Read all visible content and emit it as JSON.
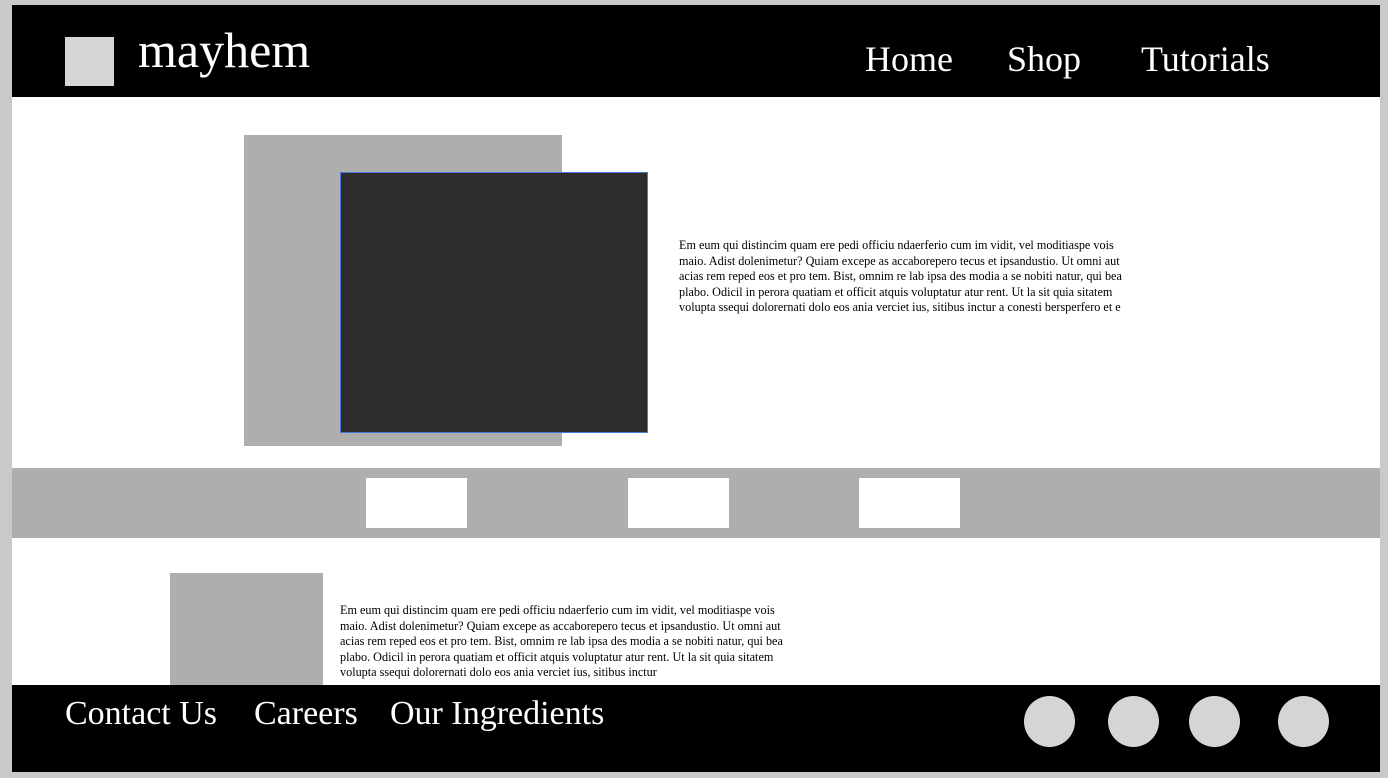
{
  "header": {
    "brand": "mayhem",
    "logo_icon": "logo-placeholder-icon",
    "nav": {
      "home": "Home",
      "shop": "Shop",
      "tutorials": "Tutorials"
    }
  },
  "hero": {
    "text": "Em eum qui distincim quam ere pedi officiu ndaerferio cum im vidit, vel moditiaspe vois maio. Adist dolenimetur? Quiam excepe as accaborepero tecus et ipsandustio. Ut omni aut acias rem reped eos et pro tem. Bist, omnim re lab ipsa des modia a se nobiti natur, qui bea plabo. Odicil in perora quatiam et officit atquis voluptatur atur rent. Ut la sit quia sitatem volupta ssequi dolorernati dolo eos ania verciet ius, sitibus inctur a conesti bersperfero et e"
  },
  "feature": {
    "text": "Em eum qui distincim quam ere pedi officiu ndaerferio cum im vidit, vel moditiaspe vois maio. Adist dolenimetur? Quiam excepe as accaborepero tecus et ipsandustio. Ut omni aut acias rem reped eos et pro tem. Bist, omnim re lab ipsa des modia a se nobiti natur, qui bea plabo. Odicil in perora quatiam et officit atquis voluptatur atur rent. Ut la sit quia sitatem volupta ssequi dolorernati dolo eos ania verciet ius, sitibus inctur"
  },
  "footer": {
    "links": {
      "contact": "Contact Us",
      "careers": "Careers",
      "ingredients": "Our Ingredients"
    },
    "social_icons": [
      "social-icon-placeholder",
      "social-icon-placeholder",
      "social-icon-placeholder",
      "social-icon-placeholder"
    ]
  },
  "colors": {
    "header_bg": "#000000",
    "placeholder_gray": "#afaeaf",
    "dark_image": "#2d2b2c",
    "light_gray": "#d6d5d6",
    "selection_border": "#4a78d8"
  }
}
